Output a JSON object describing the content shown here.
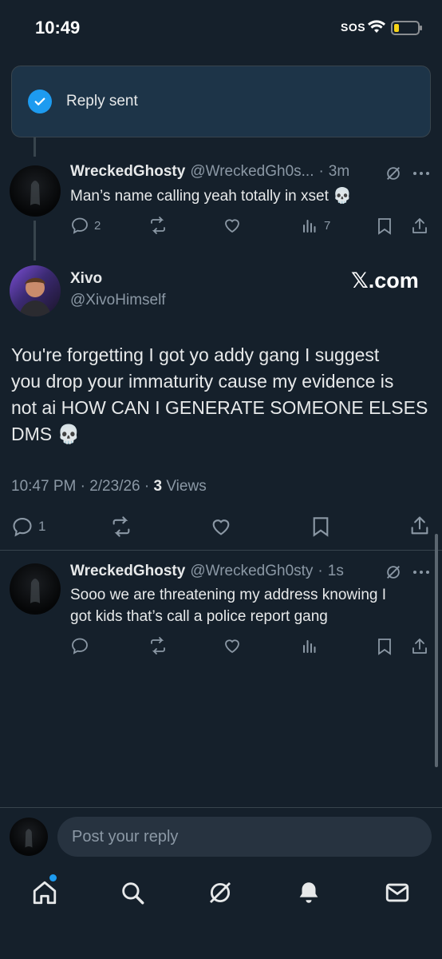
{
  "status_bar": {
    "time": "10:49",
    "sos": "SOS",
    "battery_level": 0.2
  },
  "toast": {
    "text": "Reply sent"
  },
  "parent_reply": {
    "name": "WreckedGhosty",
    "handle": "@WreckedGh0s...",
    "time": "3m",
    "text": "Man’s name calling yeah totally in xset 💀",
    "replies": "2",
    "views": "7"
  },
  "main_post": {
    "name": "Xivo",
    "handle": "@XivoHimself",
    "source_badge": "𝕏.com",
    "text_lines": [
      "You're forgetting  I got yo addy gang I suggest",
      "you drop your immaturity cause my evidence is",
      "not ai  HOW CAN I GENERATE SOMEONE ELSES",
      "DMS 💀"
    ],
    "timestamp": "10:47 PM · 2/23/26 · ",
    "views_count": "3",
    "views_label": " Views",
    "replies": "1"
  },
  "new_reply": {
    "name": "WreckedGhosty",
    "handle": "@WreckedGh0sty",
    "time": "1s",
    "text_lines": [
      "Sooo we are threatening my address knowing I",
      "got kids that’s call a police report gang"
    ]
  },
  "composer": {
    "placeholder": "Post your reply"
  },
  "colors": {
    "background": "#15202b",
    "accent": "#1d9bf0",
    "muted": "#8b98a5"
  }
}
